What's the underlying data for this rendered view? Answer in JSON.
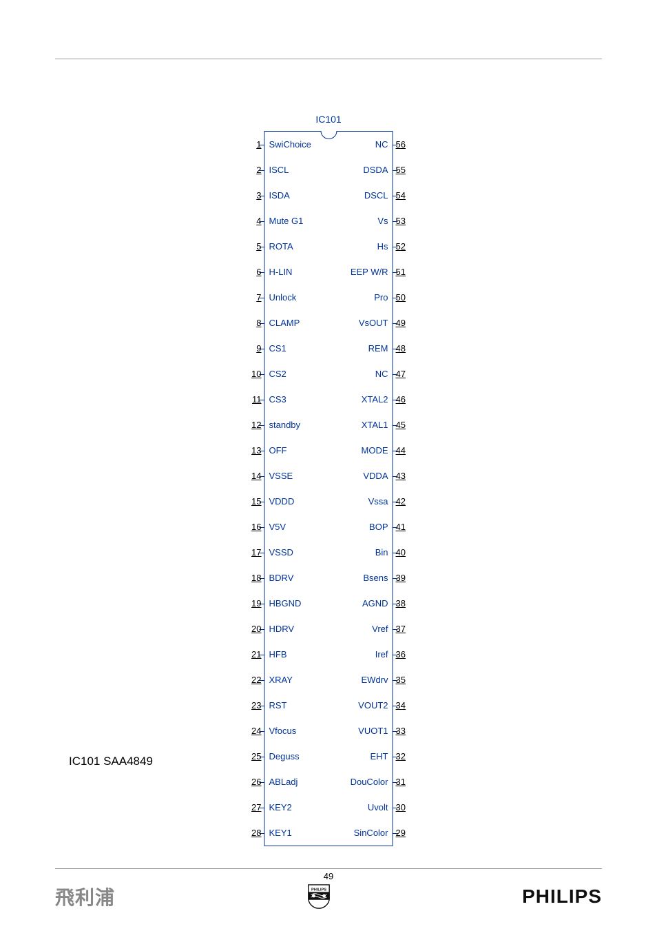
{
  "chart_data": {
    "type": "table",
    "title": "IC101",
    "pins": [
      {
        "num_left": "1",
        "name_left": "SwiChoice",
        "name_right": "NC",
        "num_right": "56"
      },
      {
        "num_left": "2",
        "name_left": "ISCL",
        "name_right": "DSDA",
        "num_right": "55"
      },
      {
        "num_left": "3",
        "name_left": "ISDA",
        "name_right": "DSCL",
        "num_right": "54"
      },
      {
        "num_left": "4",
        "name_left": "Mute G1",
        "name_right": "Vs",
        "num_right": "53"
      },
      {
        "num_left": "5",
        "name_left": "ROTA",
        "name_right": "Hs",
        "num_right": "52"
      },
      {
        "num_left": "6",
        "name_left": "H-LIN",
        "name_right": "EEP W/R",
        "num_right": "51"
      },
      {
        "num_left": "7",
        "name_left": "Unlock",
        "name_right": "Pro",
        "num_right": "50"
      },
      {
        "num_left": "8",
        "name_left": "CLAMP",
        "name_right": "VsOUT",
        "num_right": "49"
      },
      {
        "num_left": "9",
        "name_left": "CS1",
        "name_right": "REM",
        "num_right": "48"
      },
      {
        "num_left": "10",
        "name_left": "CS2",
        "name_right": "NC",
        "num_right": "47"
      },
      {
        "num_left": "11",
        "name_left": "CS3",
        "name_right": "XTAL2",
        "num_right": "46"
      },
      {
        "num_left": "12",
        "name_left": "standby",
        "name_right": "XTAL1",
        "num_right": "45"
      },
      {
        "num_left": "13",
        "name_left": "OFF",
        "name_right": "MODE",
        "num_right": "44"
      },
      {
        "num_left": "14",
        "name_left": "VSSE",
        "name_right": "VDDA",
        "num_right": "43"
      },
      {
        "num_left": "15",
        "name_left": "VDDD",
        "name_right": "Vssa",
        "num_right": "42"
      },
      {
        "num_left": "16",
        "name_left": "V5V",
        "name_right": "BOP",
        "num_right": "41"
      },
      {
        "num_left": "17",
        "name_left": "VSSD",
        "name_right": "Bin",
        "num_right": "40"
      },
      {
        "num_left": "18",
        "name_left": "BDRV",
        "name_right": "Bsens",
        "num_right": "39"
      },
      {
        "num_left": "19",
        "name_left": "HBGND",
        "name_right": "AGND",
        "num_right": "38"
      },
      {
        "num_left": "20",
        "name_left": "HDRV",
        "name_right": "Vref",
        "num_right": "37"
      },
      {
        "num_left": "21",
        "name_left": "HFB",
        "name_right": "Iref",
        "num_right": "36"
      },
      {
        "num_left": "22",
        "name_left": "XRAY",
        "name_right": "EWdrv",
        "num_right": "35"
      },
      {
        "num_left": "23",
        "name_left": "RST",
        "name_right": "VOUT2",
        "num_right": "34"
      },
      {
        "num_left": "24",
        "name_left": "Vfocus",
        "name_right": "VUOT1",
        "num_right": "33"
      },
      {
        "num_left": "25",
        "name_left": "Deguss",
        "name_right": "EHT",
        "num_right": "32"
      },
      {
        "num_left": "26",
        "name_left": "ABLadj",
        "name_right": "DouColor",
        "num_right": "31"
      },
      {
        "num_left": "27",
        "name_left": "KEY2",
        "name_right": "Uvolt",
        "num_right": "30"
      },
      {
        "num_left": "28",
        "name_left": "KEY1",
        "name_right": "SinColor",
        "num_right": "29"
      }
    ]
  },
  "side_label": "IC101   SAA4849",
  "page_number": "49",
  "footer": {
    "logo_cn": "飛利浦",
    "shield_text": "PHILIPS",
    "logo_en": "PHILIPS"
  }
}
